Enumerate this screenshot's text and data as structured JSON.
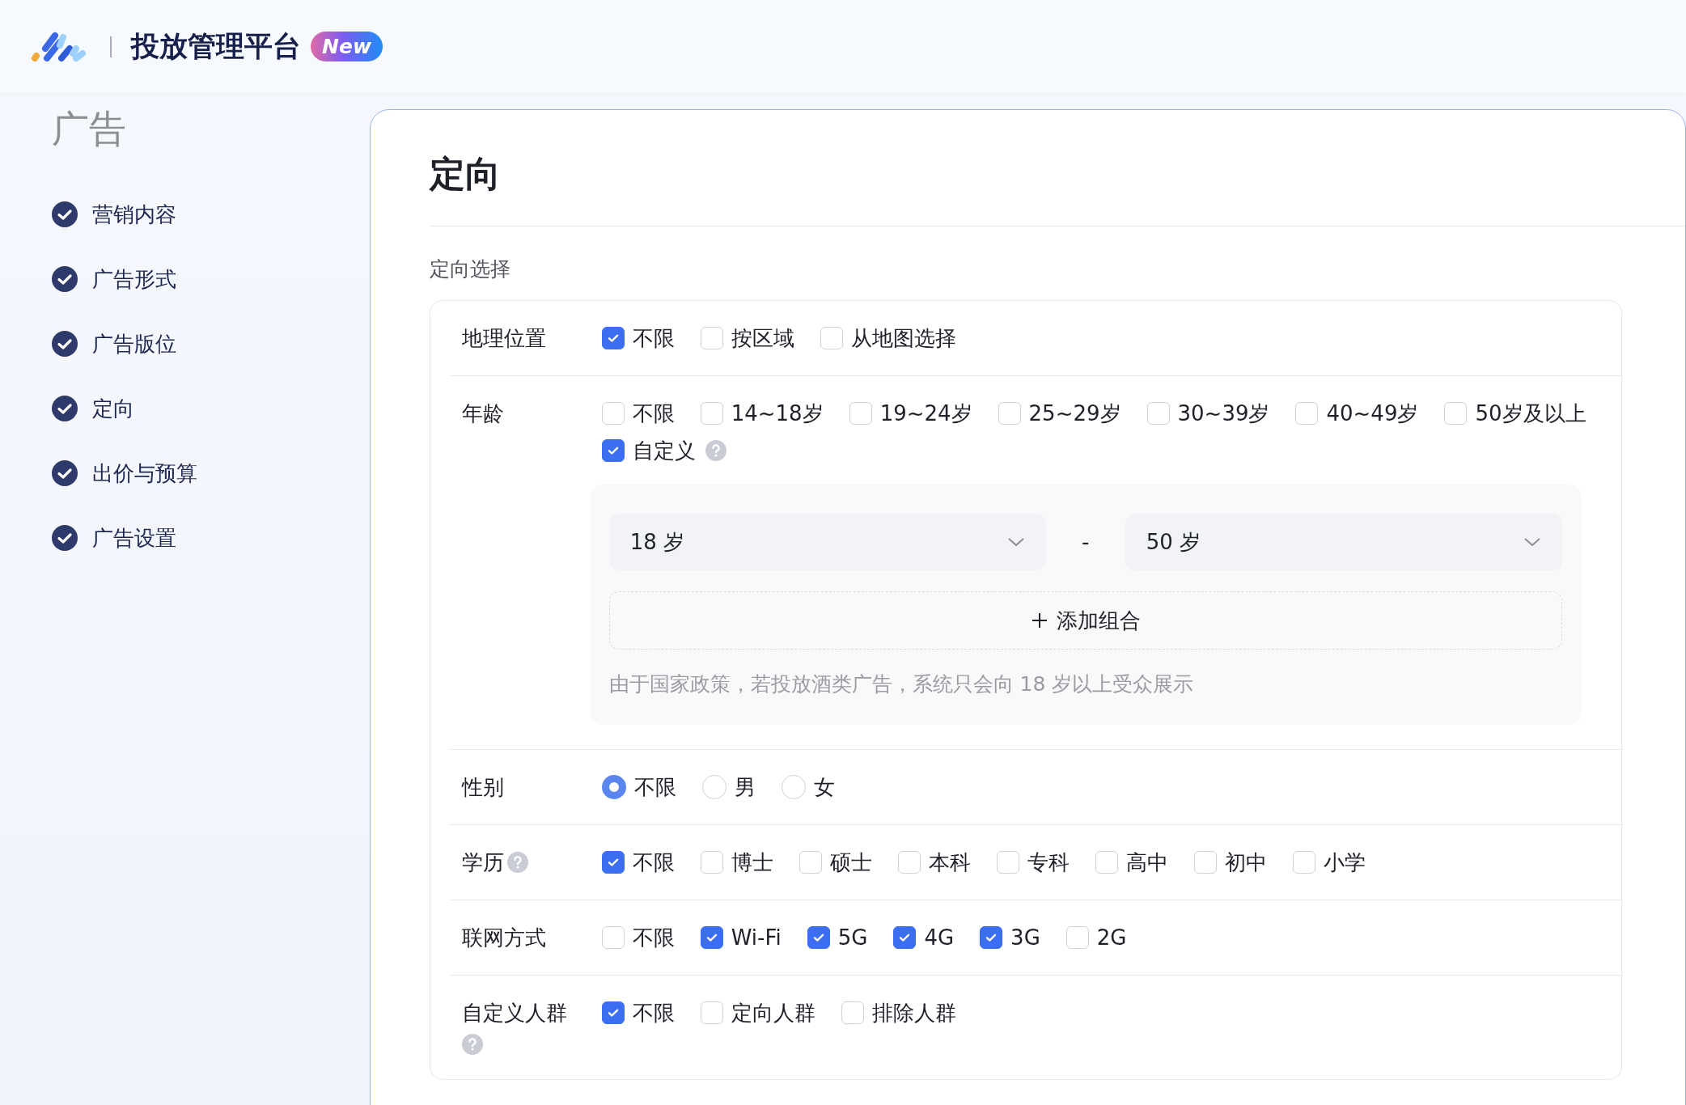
{
  "header": {
    "title": "投放管理平台",
    "badge": "New"
  },
  "sidebar": {
    "heading": "广告",
    "items": [
      {
        "label": "营销内容",
        "done": true
      },
      {
        "label": "广告形式",
        "done": true
      },
      {
        "label": "广告版位",
        "done": true
      },
      {
        "label": "定向",
        "done": true
      },
      {
        "label": "出价与预算",
        "done": true
      },
      {
        "label": "广告设置",
        "done": true
      }
    ]
  },
  "card": {
    "title": "定向",
    "section": "定向选择",
    "rows": [
      {
        "label": "地理位置",
        "help": false,
        "kind": "checkbox",
        "options": [
          {
            "label": "不限",
            "checked": true,
            "help": false
          },
          {
            "label": "按区域",
            "checked": false,
            "help": false
          },
          {
            "label": "从地图选择",
            "checked": false,
            "help": false
          }
        ]
      },
      {
        "label": "年龄",
        "help": false,
        "kind": "checkbox",
        "options": [
          {
            "label": "不限",
            "checked": false,
            "help": false
          },
          {
            "label": "14~18岁",
            "checked": false,
            "help": false
          },
          {
            "label": "19~24岁",
            "checked": false,
            "help": false
          },
          {
            "label": "25~29岁",
            "checked": false,
            "help": false
          },
          {
            "label": "30~39岁",
            "checked": false,
            "help": false
          },
          {
            "label": "40~49岁",
            "checked": false,
            "help": false
          },
          {
            "label": "50岁及以上",
            "checked": false,
            "help": false
          },
          {
            "label": "自定义",
            "checked": true,
            "help": true
          }
        ],
        "custom": {
          "ranges": [
            {
              "from": "18 岁",
              "separator": "-",
              "to": "50 岁"
            }
          ],
          "add_button": "添加组合",
          "note": "由于国家政策，若投放酒类广告，系统只会向 18 岁以上受众展示"
        }
      },
      {
        "label": "性别",
        "help": false,
        "kind": "radio",
        "options": [
          {
            "label": "不限",
            "selected": true,
            "help": false
          },
          {
            "label": "男",
            "selected": false,
            "help": false
          },
          {
            "label": "女",
            "selected": false,
            "help": false
          }
        ]
      },
      {
        "label": "学历",
        "help": true,
        "kind": "checkbox",
        "options": [
          {
            "label": "不限",
            "checked": true,
            "help": false
          },
          {
            "label": "博士",
            "checked": false,
            "help": false
          },
          {
            "label": "硕士",
            "checked": false,
            "help": false
          },
          {
            "label": "本科",
            "checked": false,
            "help": false
          },
          {
            "label": "专科",
            "checked": false,
            "help": false
          },
          {
            "label": "高中",
            "checked": false,
            "help": false
          },
          {
            "label": "初中",
            "checked": false,
            "help": false
          },
          {
            "label": "小学",
            "checked": false,
            "help": false
          }
        ]
      },
      {
        "label": "联网方式",
        "help": false,
        "kind": "checkbox",
        "options": [
          {
            "label": "不限",
            "checked": false,
            "help": false
          },
          {
            "label": "Wi-Fi",
            "checked": true,
            "help": false
          },
          {
            "label": "5G",
            "checked": true,
            "help": false
          },
          {
            "label": "4G",
            "checked": true,
            "help": false
          },
          {
            "label": "3G",
            "checked": true,
            "help": false
          },
          {
            "label": "2G",
            "checked": false,
            "help": false
          }
        ]
      },
      {
        "label": "自定义人群",
        "help": true,
        "kind": "checkbox",
        "options": [
          {
            "label": "不限",
            "checked": true,
            "help": false
          },
          {
            "label": "定向人群",
            "checked": false,
            "help": false
          },
          {
            "label": "排除人群",
            "checked": false,
            "help": false
          }
        ]
      }
    ]
  }
}
